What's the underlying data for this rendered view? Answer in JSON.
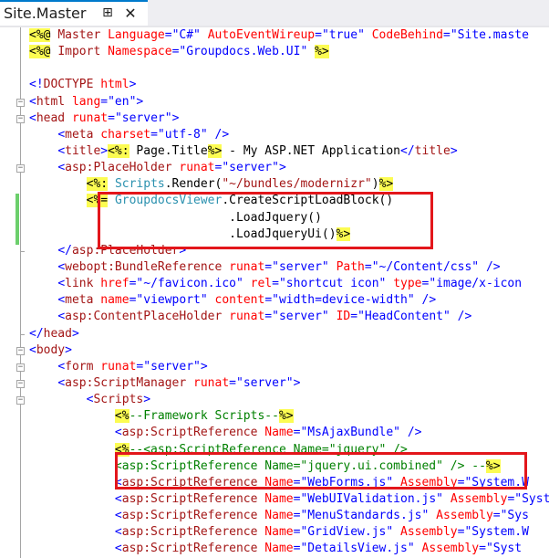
{
  "tab": {
    "title": "Site.Master",
    "pin_glyph": "⊞",
    "close_glyph": "✕"
  },
  "lines": [
    [
      [
        "d",
        "<%@"
      ],
      [
        "k",
        " "
      ],
      [
        "m",
        "Master"
      ],
      [
        "k",
        " "
      ],
      [
        "a",
        "Language"
      ],
      [
        "b",
        "="
      ],
      [
        "s",
        "\"C#\""
      ],
      [
        "k",
        " "
      ],
      [
        "a",
        "AutoEventWireup"
      ],
      [
        "b",
        "="
      ],
      [
        "s",
        "\"true\""
      ],
      [
        "k",
        " "
      ],
      [
        "a",
        "CodeBehind"
      ],
      [
        "b",
        "="
      ],
      [
        "s",
        "\"Site.maste"
      ]
    ],
    [
      [
        "d",
        "<%@"
      ],
      [
        "k",
        " "
      ],
      [
        "m",
        "Import"
      ],
      [
        "k",
        " "
      ],
      [
        "a",
        "Namespace"
      ],
      [
        "b",
        "="
      ],
      [
        "s",
        "\"Groupdocs.Web.UI\""
      ],
      [
        "k",
        " "
      ],
      [
        "d",
        "%>"
      ]
    ],
    [
      [
        "k",
        ""
      ]
    ],
    [
      [
        "b",
        "<!"
      ],
      [
        "m",
        "DOCTYPE"
      ],
      [
        "k",
        " "
      ],
      [
        "a",
        "html"
      ],
      [
        "b",
        ">"
      ]
    ],
    [
      [
        "b",
        "<"
      ],
      [
        "m",
        "html"
      ],
      [
        "k",
        " "
      ],
      [
        "a",
        "lang"
      ],
      [
        "b",
        "="
      ],
      [
        "s",
        "\"en\""
      ],
      [
        "b",
        ">"
      ]
    ],
    [
      [
        "b",
        "<"
      ],
      [
        "m",
        "head"
      ],
      [
        "k",
        " "
      ],
      [
        "a",
        "runat"
      ],
      [
        "b",
        "="
      ],
      [
        "s",
        "\"server\""
      ],
      [
        "b",
        ">"
      ]
    ],
    [
      [
        "k",
        "    "
      ],
      [
        "b",
        "<"
      ],
      [
        "m",
        "meta"
      ],
      [
        "k",
        " "
      ],
      [
        "a",
        "charset"
      ],
      [
        "b",
        "="
      ],
      [
        "s",
        "\"utf-8\""
      ],
      [
        "k",
        " "
      ],
      [
        "b",
        "/>"
      ]
    ],
    [
      [
        "k",
        "    "
      ],
      [
        "b",
        "<"
      ],
      [
        "m",
        "title"
      ],
      [
        "b",
        ">"
      ],
      [
        "d",
        "<%:"
      ],
      [
        "k",
        " Page.Title"
      ],
      [
        "d",
        "%>"
      ],
      [
        "k",
        " - My ASP.NET Application"
      ],
      [
        "b",
        "</"
      ],
      [
        "m",
        "title"
      ],
      [
        "b",
        ">"
      ]
    ],
    [
      [
        "k",
        "    "
      ],
      [
        "b",
        "<"
      ],
      [
        "m",
        "asp:PlaceHolder"
      ],
      [
        "k",
        " "
      ],
      [
        "a",
        "runat"
      ],
      [
        "b",
        "="
      ],
      [
        "s",
        "\"server\""
      ],
      [
        "b",
        ">"
      ]
    ],
    [
      [
        "k",
        "        "
      ],
      [
        "d",
        "<%:"
      ],
      [
        "k",
        " "
      ],
      [
        "t",
        "Scripts"
      ],
      [
        "k",
        ".Render("
      ],
      [
        "m",
        "\"~/bundles/modernizr\""
      ],
      [
        "k",
        ")"
      ],
      [
        "d",
        "%>"
      ]
    ],
    [
      [
        "k",
        "        "
      ],
      [
        "d",
        "<%="
      ],
      [
        "k",
        " "
      ],
      [
        "t",
        "GroupdocsViewer"
      ],
      [
        "k",
        ".CreateScriptLoadBlock()"
      ]
    ],
    [
      [
        "k",
        "                            .LoadJquery()"
      ]
    ],
    [
      [
        "k",
        "                            .LoadJqueryUi()"
      ],
      [
        "d",
        "%>"
      ]
    ],
    [
      [
        "k",
        "    "
      ],
      [
        "b",
        "</"
      ],
      [
        "m",
        "asp:PlaceHolder"
      ],
      [
        "b",
        ">"
      ]
    ],
    [
      [
        "k",
        "    "
      ],
      [
        "b",
        "<"
      ],
      [
        "m",
        "webopt:BundleReference"
      ],
      [
        "k",
        " "
      ],
      [
        "a",
        "runat"
      ],
      [
        "b",
        "="
      ],
      [
        "s",
        "\"server\""
      ],
      [
        "k",
        " "
      ],
      [
        "a",
        "Path"
      ],
      [
        "b",
        "="
      ],
      [
        "s",
        "\"~/Content/css\""
      ],
      [
        "k",
        " "
      ],
      [
        "b",
        "/>"
      ]
    ],
    [
      [
        "k",
        "    "
      ],
      [
        "b",
        "<"
      ],
      [
        "m",
        "link"
      ],
      [
        "k",
        " "
      ],
      [
        "a",
        "href"
      ],
      [
        "b",
        "="
      ],
      [
        "s",
        "\"~/favicon.ico\""
      ],
      [
        "k",
        " "
      ],
      [
        "a",
        "rel"
      ],
      [
        "b",
        "="
      ],
      [
        "s",
        "\"shortcut icon\""
      ],
      [
        "k",
        " "
      ],
      [
        "a",
        "type"
      ],
      [
        "b",
        "="
      ],
      [
        "s",
        "\"image/x-icon"
      ]
    ],
    [
      [
        "k",
        "    "
      ],
      [
        "b",
        "<"
      ],
      [
        "m",
        "meta"
      ],
      [
        "k",
        " "
      ],
      [
        "a",
        "name"
      ],
      [
        "b",
        "="
      ],
      [
        "s",
        "\"viewport\""
      ],
      [
        "k",
        " "
      ],
      [
        "a",
        "content"
      ],
      [
        "b",
        "="
      ],
      [
        "s",
        "\"width=device-width\""
      ],
      [
        "k",
        " "
      ],
      [
        "b",
        "/>"
      ]
    ],
    [
      [
        "k",
        "    "
      ],
      [
        "b",
        "<"
      ],
      [
        "m",
        "asp:ContentPlaceHolder"
      ],
      [
        "k",
        " "
      ],
      [
        "a",
        "runat"
      ],
      [
        "b",
        "="
      ],
      [
        "s",
        "\"server\""
      ],
      [
        "k",
        " "
      ],
      [
        "a",
        "ID"
      ],
      [
        "b",
        "="
      ],
      [
        "s",
        "\"HeadContent\""
      ],
      [
        "k",
        " "
      ],
      [
        "b",
        "/>"
      ]
    ],
    [
      [
        "b",
        "</"
      ],
      [
        "m",
        "head"
      ],
      [
        "b",
        ">"
      ]
    ],
    [
      [
        "b",
        "<"
      ],
      [
        "m",
        "body"
      ],
      [
        "b",
        ">"
      ]
    ],
    [
      [
        "k",
        "    "
      ],
      [
        "b",
        "<"
      ],
      [
        "m",
        "form"
      ],
      [
        "k",
        " "
      ],
      [
        "a",
        "runat"
      ],
      [
        "b",
        "="
      ],
      [
        "s",
        "\"server\""
      ],
      [
        "b",
        ">"
      ]
    ],
    [
      [
        "k",
        "    "
      ],
      [
        "b",
        "<"
      ],
      [
        "m",
        "asp:ScriptManager"
      ],
      [
        "k",
        " "
      ],
      [
        "a",
        "runat"
      ],
      [
        "b",
        "="
      ],
      [
        "s",
        "\"server\""
      ],
      [
        "b",
        ">"
      ]
    ],
    [
      [
        "k",
        "        "
      ],
      [
        "b",
        "<"
      ],
      [
        "m",
        "Scripts"
      ],
      [
        "b",
        ">"
      ]
    ],
    [
      [
        "k",
        "            "
      ],
      [
        "d",
        "<%"
      ],
      [
        "g",
        "--Framework Scripts--"
      ],
      [
        "d",
        "%>"
      ]
    ],
    [
      [
        "k",
        "            "
      ],
      [
        "b",
        "<"
      ],
      [
        "m",
        "asp:ScriptReference"
      ],
      [
        "k",
        " "
      ],
      [
        "a",
        "Name"
      ],
      [
        "b",
        "="
      ],
      [
        "s",
        "\"MsAjaxBundle\""
      ],
      [
        "k",
        " "
      ],
      [
        "b",
        "/>"
      ]
    ],
    [
      [
        "k",
        "            "
      ],
      [
        "d",
        "<%"
      ],
      [
        "g",
        "--<asp:ScriptReference Name=\"jquery\" />"
      ]
    ],
    [
      [
        "g",
        "            <asp:ScriptReference Name=\"jquery.ui.combined\" /> --"
      ],
      [
        "d",
        "%>"
      ]
    ],
    [
      [
        "k",
        "            "
      ],
      [
        "b",
        "<"
      ],
      [
        "m",
        "asp:ScriptReference"
      ],
      [
        "k",
        " "
      ],
      [
        "a",
        "Name"
      ],
      [
        "b",
        "="
      ],
      [
        "s",
        "\"WebForms.js\""
      ],
      [
        "k",
        " "
      ],
      [
        "a",
        "Assembly"
      ],
      [
        "b",
        "="
      ],
      [
        "s",
        "\"System.W"
      ]
    ],
    [
      [
        "k",
        "            "
      ],
      [
        "b",
        "<"
      ],
      [
        "m",
        "asp:ScriptReference"
      ],
      [
        "k",
        " "
      ],
      [
        "a",
        "Name"
      ],
      [
        "b",
        "="
      ],
      [
        "s",
        "\"WebUIValidation.js\""
      ],
      [
        "k",
        " "
      ],
      [
        "a",
        "Assembly"
      ],
      [
        "b",
        "="
      ],
      [
        "s",
        "\"Syste"
      ]
    ],
    [
      [
        "k",
        "            "
      ],
      [
        "b",
        "<"
      ],
      [
        "m",
        "asp:ScriptReference"
      ],
      [
        "k",
        " "
      ],
      [
        "a",
        "Name"
      ],
      [
        "b",
        "="
      ],
      [
        "s",
        "\"MenuStandards.js\""
      ],
      [
        "k",
        " "
      ],
      [
        "a",
        "Assembly"
      ],
      [
        "b",
        "="
      ],
      [
        "s",
        "\"Sys"
      ]
    ],
    [
      [
        "k",
        "            "
      ],
      [
        "b",
        "<"
      ],
      [
        "m",
        "asp:ScriptReference"
      ],
      [
        "k",
        " "
      ],
      [
        "a",
        "Name"
      ],
      [
        "b",
        "="
      ],
      [
        "s",
        "\"GridView.js\""
      ],
      [
        "k",
        " "
      ],
      [
        "a",
        "Assembly"
      ],
      [
        "b",
        "="
      ],
      [
        "s",
        "\"System.W"
      ]
    ],
    [
      [
        "k",
        "            "
      ],
      [
        "b",
        "<"
      ],
      [
        "m",
        "asp:ScriptReference"
      ],
      [
        "k",
        " "
      ],
      [
        "a",
        "Name"
      ],
      [
        "b",
        "="
      ],
      [
        "s",
        "\"DetailsView.js\""
      ],
      [
        "k",
        " "
      ],
      [
        "a",
        "Assembly"
      ],
      [
        "b",
        "="
      ],
      [
        "s",
        "\"Syst"
      ]
    ]
  ],
  "colors": {
    "directive_highlight": "#fcfc52",
    "tag_delimiter": "#0000ff",
    "element_name": "#a31515",
    "attribute_name": "#ff0000",
    "attribute_value": "#0000ff",
    "comment": "#008000",
    "type_name": "#2b91af",
    "callout_border": "#e3161b",
    "changed_line_bar": "#6ccf6c",
    "active_tab_accent": "#007acc"
  }
}
